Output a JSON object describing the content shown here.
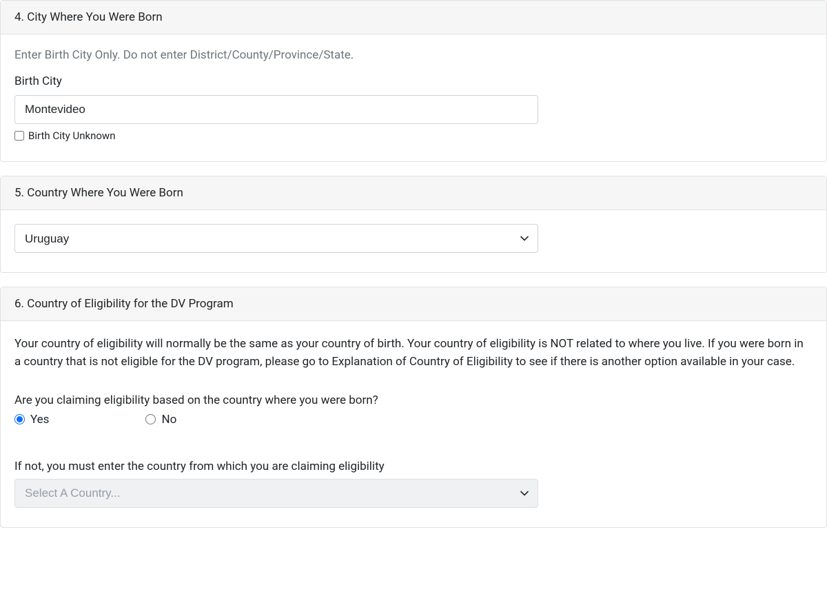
{
  "section4": {
    "header": "4. City Where You Were Born",
    "helper": "Enter Birth City Only. Do not enter District/County/Province/State.",
    "label": "Birth City",
    "value": "Montevideo",
    "unknown_label": "Birth City Unknown",
    "unknown_checked": false
  },
  "section5": {
    "header": "5. Country Where You Were Born",
    "selected": "Uruguay"
  },
  "section6": {
    "header": "6. Country of Eligibility for the DV Program",
    "body": "Your country of eligibility will normally be the same as your country of birth. Your country of eligibility is NOT related to where you live. If you were born in a country that is not eligible for the DV program, please go to Explanation of Country of Eligibility to see if there is another option available in your case.",
    "question": "Are you claiming eligibility based on the country where you were born?",
    "yes_label": "Yes",
    "no_label": "No",
    "selected_radio": "yes",
    "ifnot_label": "If not, you must enter the country from which you are claiming eligibility",
    "ifnot_placeholder": "Select A Country..."
  }
}
